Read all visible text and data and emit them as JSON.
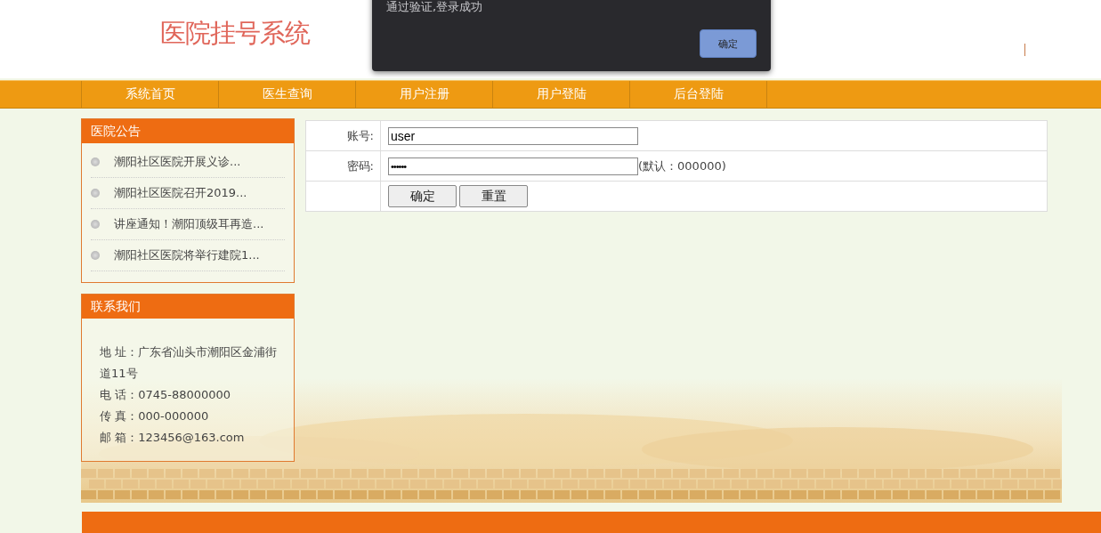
{
  "header": {
    "title": "医院挂号系统"
  },
  "dialog": {
    "message": "通过验证,登录成功",
    "button": "确定"
  },
  "nav": [
    {
      "label": "系统首页"
    },
    {
      "label": "医生查询"
    },
    {
      "label": "用户注册"
    },
    {
      "label": "用户登陆"
    },
    {
      "label": "后台登陆"
    }
  ],
  "notices": {
    "title": "医院公告",
    "items": [
      "潮阳社区医院开展义诊...",
      "潮阳社区医院召开2019...",
      "讲座通知！潮阳顶级耳再造...",
      "潮阳社区医院将举行建院1..."
    ]
  },
  "contact": {
    "title": "联系我们",
    "lines": [
      "地 址：广东省汕头市潮阳区金浦街道11号",
      "电 话：0745-88000000",
      "传 真：000-000000",
      "邮 箱：123456@163.com"
    ]
  },
  "login_form": {
    "fields": [
      {
        "label": "账号:",
        "value": "user",
        "kind": "text"
      },
      {
        "label": "密码:",
        "value": "••••••",
        "kind": "password",
        "hint": "(默认：000000)"
      }
    ],
    "buttons": [
      "确定",
      "重置"
    ]
  }
}
